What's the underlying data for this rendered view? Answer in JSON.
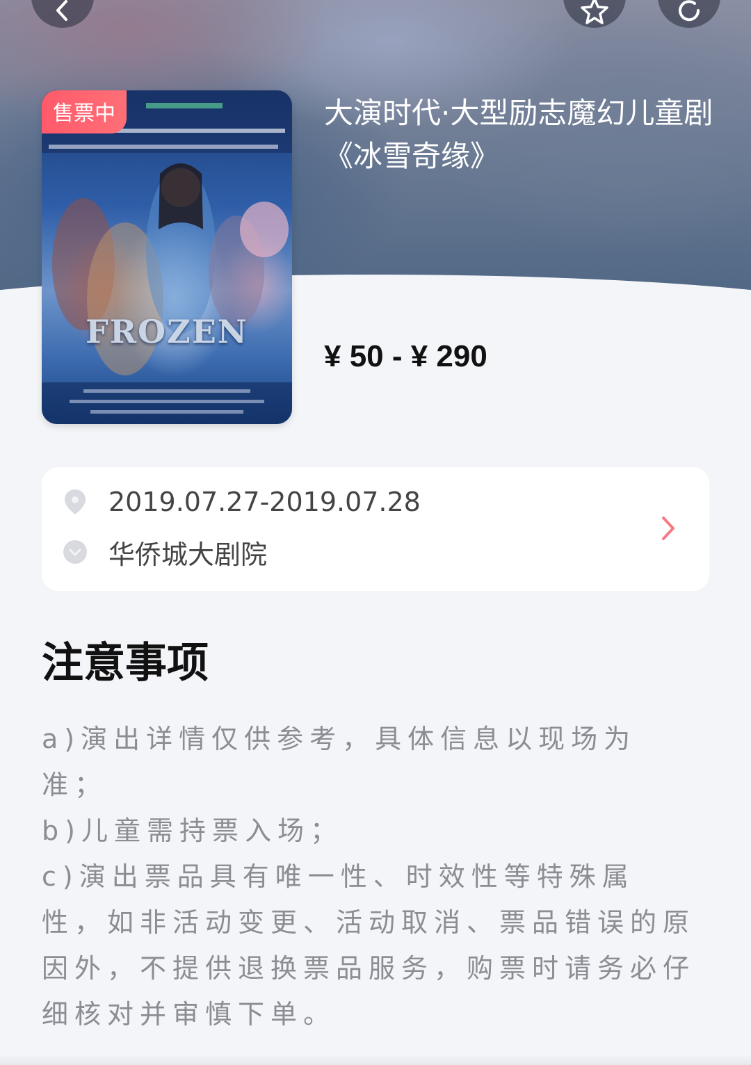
{
  "header": {
    "back_icon": "chevron-left-icon",
    "favorite_icon": "star-icon",
    "share_icon": "refresh-icon"
  },
  "poster": {
    "badge": "售票中",
    "art_text": "FROZEN"
  },
  "show": {
    "title": "大演时代·大型励志魔幻儿童剧《冰雪奇缘》",
    "price": "¥ 50 - ¥ 290"
  },
  "info": {
    "date": "2019.07.27-2019.07.28",
    "venue": "华侨城大剧院",
    "date_icon": "location-pin-icon",
    "venue_icon": "chevron-down-circle-icon",
    "arrow_color": "#f47b86"
  },
  "notice": {
    "title": "注意事项",
    "lines": [
      "a)演出详情仅供参考，具体信息以现场为",
      "准；",
      "b)儿童需持票入场；",
      "c)演出票品具有唯一性、时效性等特殊属",
      "性，如非活动变更、活动取消、票品错误的原",
      "因外，不提供退换票品服务，购票时请务必仔",
      "细核对并审慎下单。"
    ]
  },
  "colors": {
    "badge": "#ff5a6b",
    "background": "#f3f5f8"
  }
}
